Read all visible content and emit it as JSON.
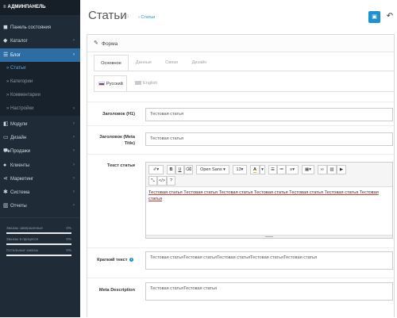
{
  "app": {
    "brand": "АДМИНПАНЕЛЬ"
  },
  "sidebar": {
    "items": [
      {
        "label": "Панель состояния",
        "icon": "dashboard-icon",
        "glyph": "◼"
      },
      {
        "label": "Каталог",
        "icon": "tag-icon",
        "glyph": "◆"
      },
      {
        "label": "Блог",
        "icon": "list-icon",
        "glyph": "☰"
      },
      {
        "label": "Модули",
        "icon": "puzzle-icon",
        "glyph": "◧"
      },
      {
        "label": "Дизайн",
        "icon": "monitor-icon",
        "glyph": "▭"
      },
      {
        "label": "Продажи",
        "icon": "cart-icon",
        "glyph": "⛟"
      },
      {
        "label": "Клиенты",
        "icon": "user-icon",
        "glyph": "●"
      },
      {
        "label": "Маркетинг",
        "icon": "share-icon",
        "glyph": "⋖"
      },
      {
        "label": "Система",
        "icon": "gear-icon",
        "glyph": "✱"
      },
      {
        "label": "Отчеты",
        "icon": "bar-chart-icon",
        "glyph": "▥"
      }
    ],
    "blog_sub": [
      {
        "label": "Статьи"
      },
      {
        "label": "Категории"
      },
      {
        "label": "Комментарии"
      },
      {
        "label": "Настройки"
      }
    ],
    "stats": [
      {
        "label": "Заказы завершенные",
        "value": "0%"
      },
      {
        "label": "Заказы в процессе",
        "value": "0%"
      },
      {
        "label": "Остальные заказы",
        "value": "0%"
      }
    ]
  },
  "header": {
    "title": "Статьи",
    "breadcrumb": "Статьи",
    "save_icon": "save-icon",
    "back_icon": "reply-icon"
  },
  "panel": {
    "title": "Форма",
    "tabs": [
      "Основное",
      "Данные",
      "Связи",
      "Дизайн"
    ],
    "lang_tabs": [
      "Русский",
      "English"
    ]
  },
  "form": {
    "h1_label": "Заголовок (H1)",
    "h1_value": "Тестовая статья",
    "meta_title_label_1": "Заголовок (Meta",
    "meta_title_label_2": "Title)",
    "meta_title_value": "Тестовая статья",
    "text_label": "Текст статьи",
    "text_value": "Тестовая статья Тестовая статья Тестовая статья Тестовая статья Тестовая статья Тестовая статья Тестовая статья",
    "short_label": "Краткий текст",
    "short_value": "Тестовая статьяТестовая статьяТестовая статьяТестовая статьяТестовая статья",
    "meta_desc_label": "Meta Description",
    "meta_desc_value": "Тестовая статьяТестовая статья"
  },
  "editor": {
    "font": "Open Sans",
    "size": "13",
    "colors": {
      "accent": "#1e91cf",
      "active_nav": "#2e6da4",
      "sidebar": "#1f2b36"
    }
  }
}
